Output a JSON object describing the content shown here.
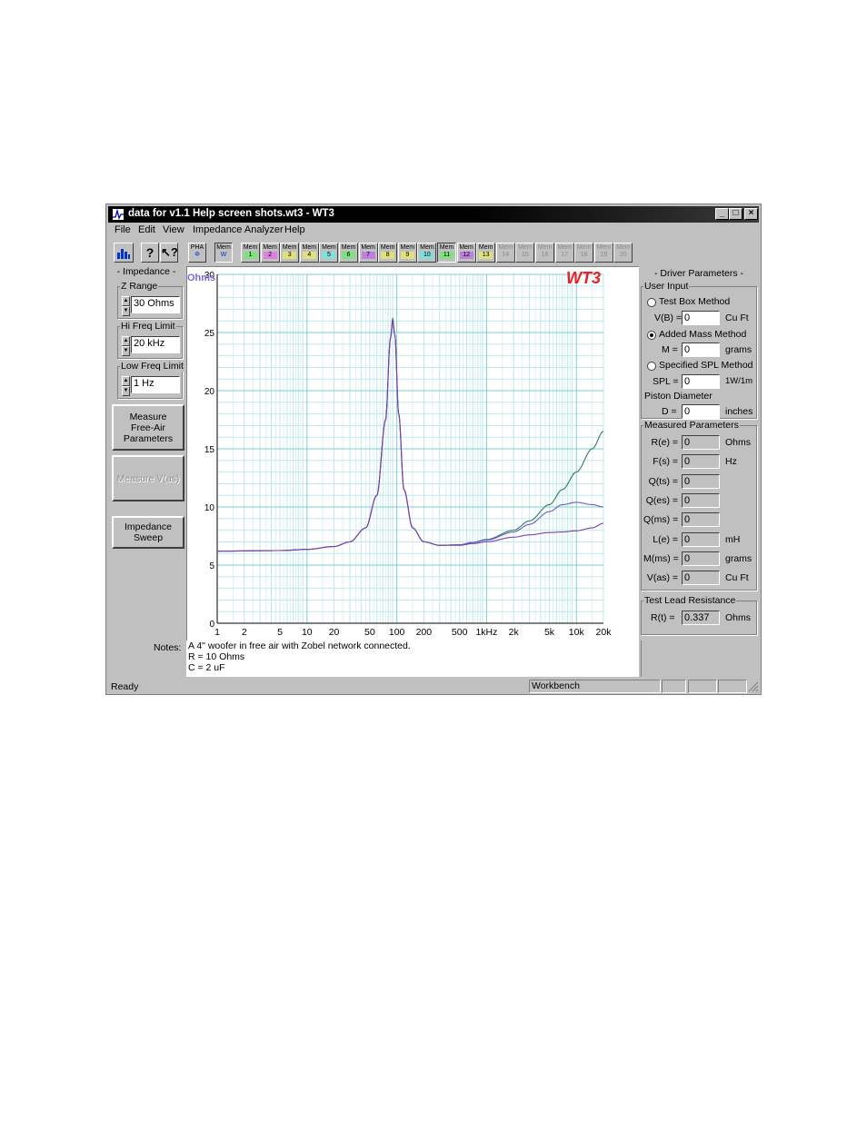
{
  "window": {
    "title": "data for v1.1 Help screen shots.wt3 - WT3",
    "controls": {
      "minimize": "_",
      "maximize": "□",
      "close": "×"
    }
  },
  "menu": [
    "File",
    "Edit",
    "View",
    "Impedance Analyzer",
    "Help"
  ],
  "toolbar": {
    "pha": {
      "line1": "PHA",
      "line2": "Φ"
    },
    "mem_w": {
      "line1": "Mem",
      "line2": "W"
    },
    "mem_label": "Mem",
    "mem_buttons": [
      {
        "n": "1",
        "color": "#7fe07f",
        "enabled": true
      },
      {
        "n": "2",
        "color": "#e07fe0",
        "enabled": true
      },
      {
        "n": "3",
        "color": "#e0e07f",
        "enabled": true
      },
      {
        "n": "4",
        "color": "#e0e07f",
        "enabled": true
      },
      {
        "n": "5",
        "color": "#7fe0e0",
        "enabled": true
      },
      {
        "n": "6",
        "color": "#7fe07f",
        "enabled": true
      },
      {
        "n": "7",
        "color": "#c07fe0",
        "enabled": true
      },
      {
        "n": "8",
        "color": "#e0e07f",
        "enabled": true
      },
      {
        "n": "9",
        "color": "#e0e07f",
        "enabled": true
      },
      {
        "n": "10",
        "color": "#7fe0e0",
        "enabled": true
      },
      {
        "n": "11",
        "color": "#7fe07f",
        "enabled": true
      },
      {
        "n": "12",
        "color": "#c07fe0",
        "enabled": true
      },
      {
        "n": "13",
        "color": "#e0e07f",
        "enabled": true
      },
      {
        "n": "14",
        "color": "",
        "enabled": false
      },
      {
        "n": "15",
        "color": "",
        "enabled": false
      },
      {
        "n": "16",
        "color": "",
        "enabled": false
      },
      {
        "n": "17",
        "color": "",
        "enabled": false
      },
      {
        "n": "18",
        "color": "",
        "enabled": false
      },
      {
        "n": "19",
        "color": "",
        "enabled": false
      },
      {
        "n": "20",
        "color": "",
        "enabled": false
      }
    ]
  },
  "impedance_panel": {
    "title": "- Impedance -",
    "z_range": {
      "label": "Z Range",
      "value": "30 Ohms"
    },
    "hi_freq": {
      "label": "Hi Freq Limit",
      "value": "20 kHz"
    },
    "low_freq": {
      "label": "Low Freq Limit",
      "value": "1 Hz"
    },
    "measure_free_air": "Measure Free-Air Parameters",
    "measure_vas": "Measure V(as)",
    "impedance_sweep": "Impedance Sweep"
  },
  "chart_data": {
    "type": "line",
    "ylabel": "Ohms",
    "watermark": "WT3",
    "x_scale": "log",
    "xlim": [
      1,
      20000
    ],
    "ylim": [
      0,
      30
    ],
    "grid": true,
    "y_ticks": [
      "0",
      "5",
      "10",
      "15",
      "20",
      "25",
      "30"
    ],
    "x_ticks": [
      {
        "v": 1,
        "label": "1"
      },
      {
        "v": 2,
        "label": "2"
      },
      {
        "v": 5,
        "label": "5"
      },
      {
        "v": 10,
        "label": "10"
      },
      {
        "v": 20,
        "label": "20"
      },
      {
        "v": 50,
        "label": "50"
      },
      {
        "v": 100,
        "label": "100"
      },
      {
        "v": 200,
        "label": "200"
      },
      {
        "v": 500,
        "label": "500"
      },
      {
        "v": 1000,
        "label": "1kHz"
      },
      {
        "v": 2000,
        "label": "2k"
      },
      {
        "v": 5000,
        "label": "5k"
      },
      {
        "v": 10000,
        "label": "10k"
      },
      {
        "v": 20000,
        "label": "20k"
      }
    ],
    "series": [
      {
        "color": "#2e7d5e",
        "x": [
          1,
          5,
          10,
          20,
          30,
          45,
          60,
          75,
          85,
          90,
          95,
          105,
          120,
          150,
          200,
          300,
          500,
          700,
          1000,
          2000,
          3000,
          5000,
          7000,
          10000,
          15000,
          20000
        ],
        "y": [
          6.2,
          6.25,
          6.35,
          6.6,
          7.0,
          8.2,
          11.0,
          17.5,
          24.5,
          26.2,
          24.8,
          18.0,
          11.5,
          8.2,
          7.0,
          6.7,
          6.75,
          6.95,
          7.2,
          8.0,
          8.8,
          10.2,
          11.5,
          13.0,
          15.0,
          16.5
        ]
      },
      {
        "color": "#6a5acd",
        "x": [
          1,
          5,
          10,
          20,
          30,
          45,
          60,
          75,
          85,
          90,
          95,
          105,
          120,
          150,
          200,
          300,
          500,
          700,
          1000,
          2000,
          3000,
          5000,
          7000,
          10000,
          15000,
          20000
        ],
        "y": [
          6.2,
          6.25,
          6.35,
          6.6,
          7.0,
          8.2,
          11.0,
          17.5,
          24.5,
          26.0,
          24.8,
          18.0,
          11.5,
          8.2,
          7.0,
          6.7,
          6.75,
          6.95,
          7.15,
          7.85,
          8.5,
          9.6,
          10.2,
          10.4,
          10.2,
          10.0
        ]
      },
      {
        "color": "#7b3fb0",
        "x": [
          1,
          5,
          10,
          20,
          30,
          45,
          60,
          75,
          85,
          90,
          95,
          105,
          120,
          150,
          200,
          300,
          500,
          700,
          1000,
          2000,
          3000,
          5000,
          7000,
          10000,
          15000,
          20000
        ],
        "y": [
          6.2,
          6.25,
          6.35,
          6.6,
          7.0,
          8.2,
          11.0,
          17.5,
          24.5,
          26.0,
          24.8,
          18.0,
          11.5,
          8.2,
          7.0,
          6.7,
          6.7,
          6.85,
          7.0,
          7.4,
          7.6,
          7.8,
          7.85,
          7.95,
          8.2,
          8.6
        ]
      }
    ]
  },
  "driver_panel": {
    "title": "- Driver Parameters -",
    "user_input_label": "User Input",
    "test_box": {
      "label": "Test Box Method",
      "field_label": "V(B) =",
      "value": "0",
      "unit": "Cu Ft",
      "selected": false
    },
    "added_mass": {
      "label": "Added Mass Method",
      "field_label": "M =",
      "value": "0",
      "unit": "grams",
      "selected": true
    },
    "specified_spl": {
      "label": "Specified SPL Method",
      "field_label": "SPL =",
      "value": "0",
      "unit": "1W/1m",
      "selected": false
    },
    "piston_label": "Piston Diameter",
    "piston": {
      "field_label": "D =",
      "value": "0",
      "unit": "inches"
    },
    "measured_label": "Measured Parameters",
    "measured": [
      {
        "label": "R(e) =",
        "value": "0",
        "unit": "Ohms"
      },
      {
        "label": "F(s) =",
        "value": "0",
        "unit": "Hz"
      },
      {
        "label": "Q(ts) =",
        "value": "0",
        "unit": ""
      },
      {
        "label": "Q(es) =",
        "value": "0",
        "unit": ""
      },
      {
        "label": "Q(ms) =",
        "value": "0",
        "unit": ""
      },
      {
        "label": "L(e) =",
        "value": "0",
        "unit": "mH"
      },
      {
        "label": "M(ms) =",
        "value": "0",
        "unit": "grams"
      },
      {
        "label": "V(as) =",
        "value": "0",
        "unit": "Cu Ft"
      }
    ],
    "test_lead_label": "Test Lead Resistance",
    "test_lead": {
      "label": "R(t) =",
      "value": "0.337",
      "unit": "Ohms"
    }
  },
  "notes": {
    "label": "Notes:",
    "lines": [
      "A 4\" woofer in free air with Zobel network connected.",
      "R = 10 Ohms",
      "C = 2 uF"
    ]
  },
  "status": {
    "left": "Ready",
    "mode": "Workbench"
  }
}
